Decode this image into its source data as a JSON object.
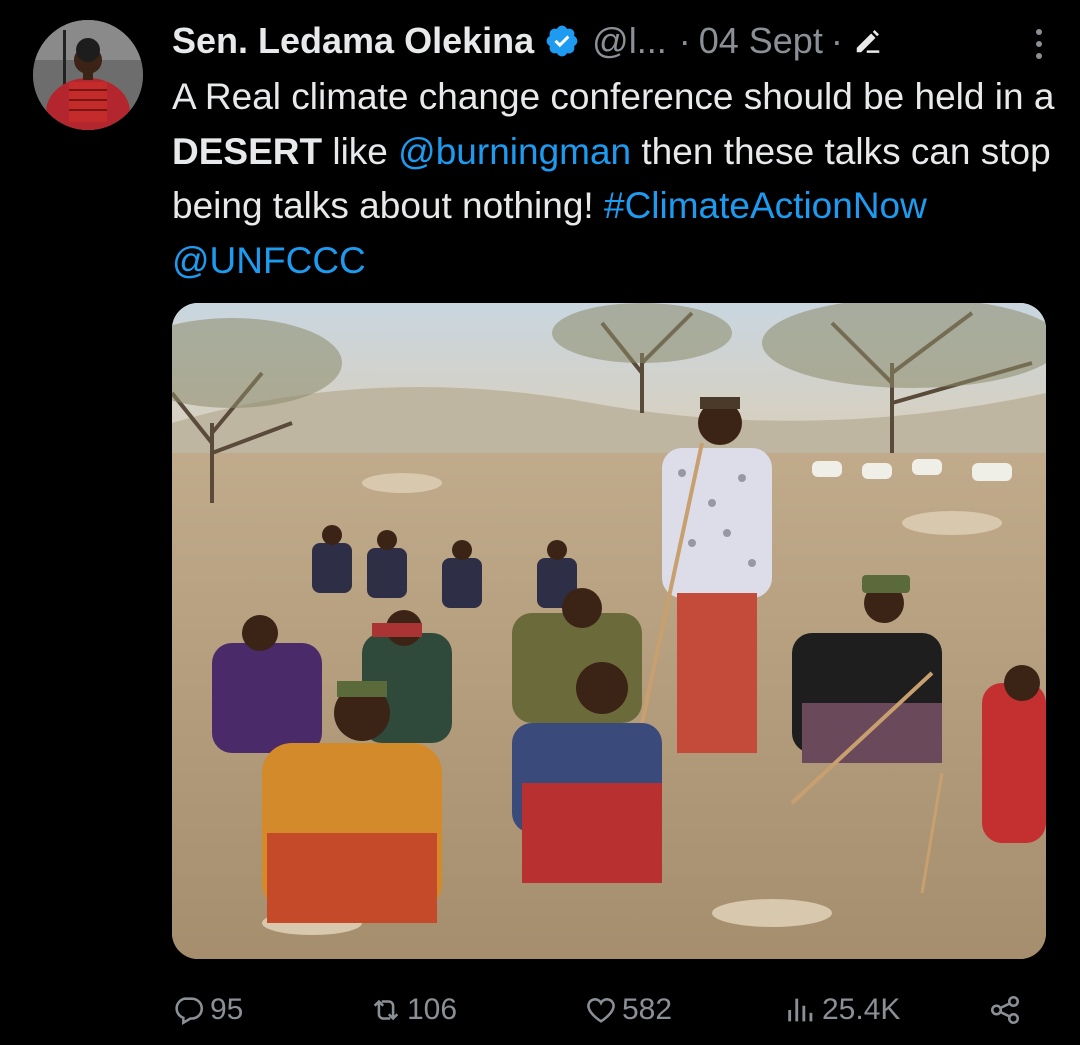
{
  "author": {
    "name": "Sen. Ledama Olekina",
    "handle": "@l...",
    "separator": "·",
    "date": "04 Sept",
    "separator2": "·",
    "verified_color": "#1d9bf0"
  },
  "tweet": {
    "part1": "A Real climate change conference should be held in a ",
    "emphasis": "DESERT",
    "part2": " like ",
    "mention1": "@burningman",
    "part3": " then these talks can stop being talks about nothing! ",
    "hashtag": "#ClimateActionNow",
    "space": " ",
    "mention2": "@UNFCCC"
  },
  "actions": {
    "replies": "95",
    "reposts": "106",
    "likes": "582",
    "views": "25.4K"
  },
  "icons": {
    "verified": "verified-badge-icon",
    "edit": "edit-pencil-icon",
    "more": "more-vertical-icon",
    "reply": "reply-icon",
    "repost": "repost-icon",
    "like": "heart-icon",
    "views": "views-bar-icon",
    "share": "share-icon"
  },
  "colors": {
    "background": "#000000",
    "text": "#e7e9ea",
    "secondary": "#8b9096",
    "link": "#1d9bf0"
  }
}
